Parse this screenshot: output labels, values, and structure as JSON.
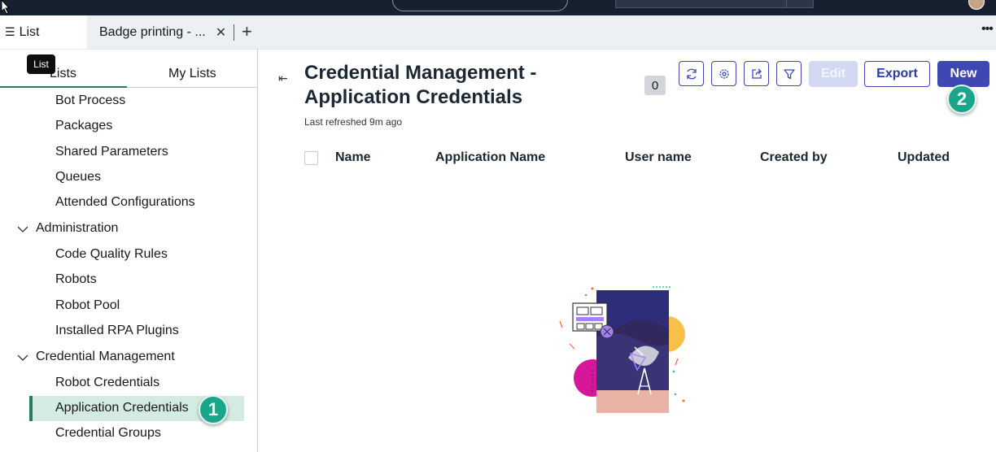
{
  "tabs": [
    {
      "label": "List",
      "active": true
    },
    {
      "label": "Badge printing - ...",
      "active": false
    }
  ],
  "tooltip": "List",
  "sidebar": {
    "tabs": [
      "Lists",
      "My Lists"
    ],
    "items": [
      {
        "label": "Bot Process",
        "type": "child"
      },
      {
        "label": "Packages",
        "type": "child"
      },
      {
        "label": "Shared Parameters",
        "type": "child"
      },
      {
        "label": "Queues",
        "type": "child"
      },
      {
        "label": "Attended Configurations",
        "type": "child"
      },
      {
        "label": "Administration",
        "type": "group",
        "expanded": true
      },
      {
        "label": "Code Quality Rules",
        "type": "child"
      },
      {
        "label": "Robots",
        "type": "child"
      },
      {
        "label": "Robot Pool",
        "type": "child"
      },
      {
        "label": "Installed RPA Plugins",
        "type": "child"
      },
      {
        "label": "Credential Management",
        "type": "group",
        "expanded": true
      },
      {
        "label": "Robot Credentials",
        "type": "child"
      },
      {
        "label": "Application Credentials",
        "type": "child",
        "selected": true
      },
      {
        "label": "Credential Groups",
        "type": "child"
      }
    ]
  },
  "steps": {
    "one": "1",
    "two": "2"
  },
  "main": {
    "title": "Credential Management - Application Credentials",
    "count": "0",
    "last_refreshed": "Last refreshed 9m ago",
    "toolbar": {
      "icons": [
        "refresh-icon",
        "settings-icon",
        "share-icon",
        "filter-icon"
      ],
      "edit_label": "Edit",
      "export_label": "Export",
      "new_label": "New"
    },
    "columns": [
      "Name",
      "Application Name",
      "User name",
      "Created by",
      "Updated"
    ]
  },
  "colors": {
    "accent": "#3e47b2",
    "selected": "#d3ebe1",
    "step_badge": "#1aa68a",
    "topbar": "#16202e"
  }
}
